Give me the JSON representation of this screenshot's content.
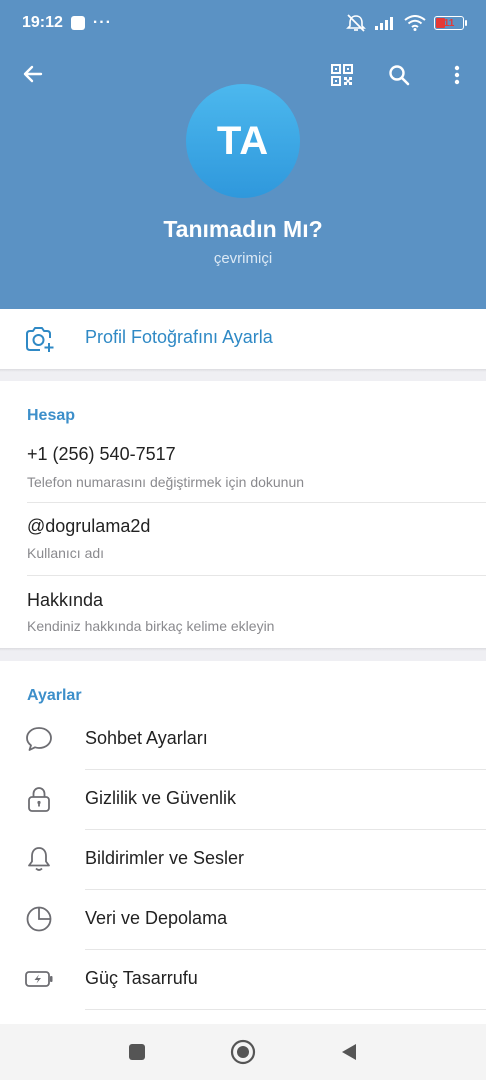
{
  "status_bar": {
    "time": "19:12",
    "dots": "···",
    "battery": "11"
  },
  "header": {
    "avatar_initials": "TA",
    "name": "Tanımadın Mı?",
    "status": "çevrimiçi",
    "background_color": "#5b92c4"
  },
  "set_photo": {
    "label": "Profil Fotoğrafını Ayarla",
    "icon": "camera-add-icon"
  },
  "account": {
    "title": "Hesap",
    "phone": {
      "value": "+1 (256) 540-7517",
      "hint": "Telefon numarasını değiştirmek için dokunun"
    },
    "username": {
      "value": "@dogrulama2d",
      "hint": "Kullanıcı adı"
    },
    "bio": {
      "value": "Hakkında",
      "hint": "Kendiniz hakkında birkaç kelime ekleyin"
    }
  },
  "settings": {
    "title": "Ayarlar",
    "items": [
      {
        "label": "Sohbet Ayarları",
        "icon": "chat-bubble-icon"
      },
      {
        "label": "Gizlilik ve Güvenlik",
        "icon": "lock-icon"
      },
      {
        "label": "Bildirimler ve Sesler",
        "icon": "bell-icon"
      },
      {
        "label": "Veri ve Depolama",
        "icon": "pie-chart-icon"
      },
      {
        "label": "Güç Tasarrufu",
        "icon": "battery-bolt-icon"
      }
    ]
  },
  "colors": {
    "accent": "#2f89c5",
    "section_title": "#3d8fca",
    "avatar_gradient_top": "#4cb8ee",
    "avatar_gradient_bottom": "#2f98dc"
  }
}
